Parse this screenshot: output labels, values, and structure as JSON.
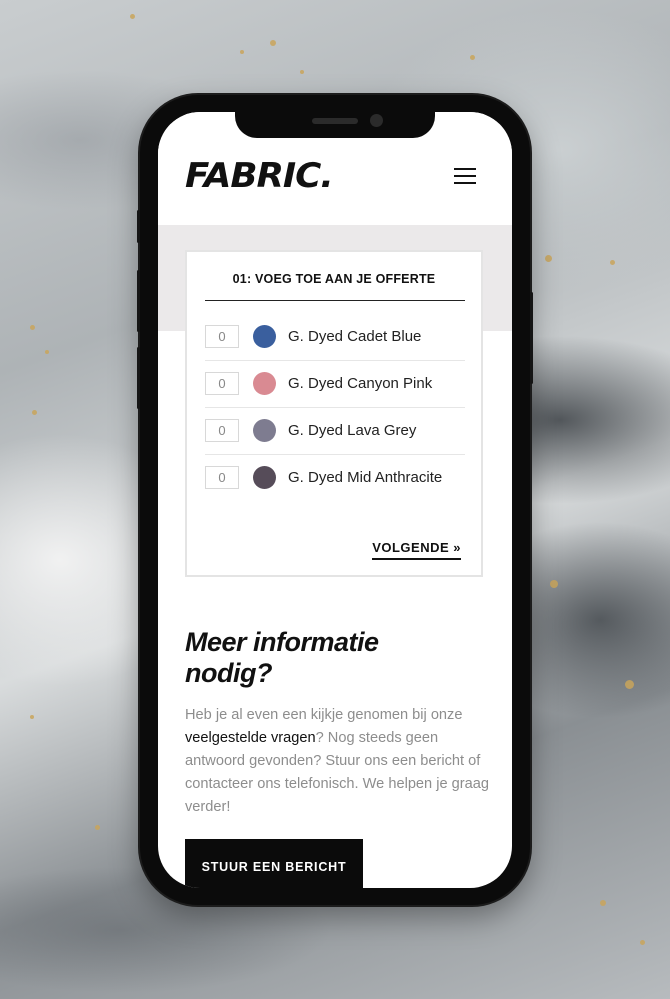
{
  "brand": {
    "logo": "FABRIC.",
    "menu_icon": "hamburger-menu-icon"
  },
  "quote_card": {
    "title": "01: VOEG TOE AAN JE OFFERTE",
    "items": [
      {
        "qty": "0",
        "label": "G. Dyed Cadet Blue",
        "color": "#3a5f9e"
      },
      {
        "qty": "0",
        "label": "G. Dyed Canyon Pink",
        "color": "#d98a92"
      },
      {
        "qty": "0",
        "label": "G. Dyed Lava Grey",
        "color": "#7e7c90"
      },
      {
        "qty": "0",
        "label": "G. Dyed Mid Anthracite",
        "color": "#564c59"
      }
    ],
    "next_label": "VOLGENDE »"
  },
  "info": {
    "title_line1": "Meer informatie",
    "title_line2": "nodig?",
    "text_before_link": "Heb je al even een kijkje genomen bij onze ",
    "link_text": "veelgestelde vragen",
    "text_after_link": "? Nog steeds geen antwoord gevonden? Stuur ons een bericht of contacteer ons telefonisch. We helpen je graag verder!",
    "cta_label": "STUUR EEN BERICHT"
  },
  "colors": {
    "accent": "#0b0b0b",
    "band": "#ebe9ea",
    "muted_text": "#8d8d8d"
  }
}
